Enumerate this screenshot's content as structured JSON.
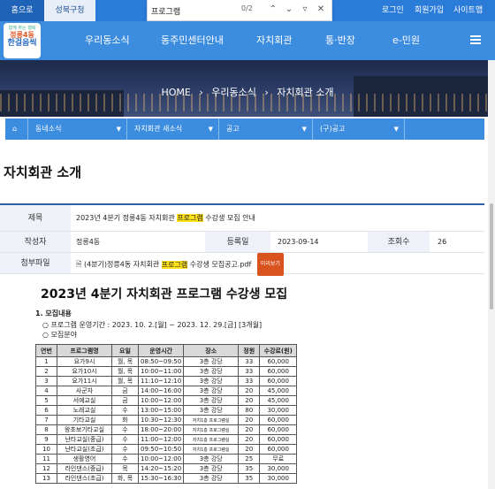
{
  "topbar": {
    "home": "홈으로",
    "district": "성북구청",
    "links": [
      "로그인",
      "회원가입",
      "사이트맵"
    ]
  },
  "findbar": {
    "query": "프로그램",
    "count": "0/2"
  },
  "logo": {
    "line1": "함께 하는 행복",
    "line2": "정릉4동",
    "line3": "한걸음씩"
  },
  "nav": [
    "우리동소식",
    "동주민센터안내",
    "자치회관",
    "통·반장",
    "e-민원"
  ],
  "breadcrumb": [
    "HOME",
    "우리동소식",
    "자치회관 소개"
  ],
  "subnav": [
    "동네소식",
    "자치회관 새소식",
    "공고",
    "(구)공고"
  ],
  "page_title": "자치회관 소개",
  "post": {
    "subject_label": "제목",
    "subject_pre": "2023년 4분기 정릉4동 자치회관 ",
    "subject_hl": "프로그램",
    "subject_post": " 수강생 모집 안내",
    "author_label": "작성자",
    "author": "정릉4동",
    "date_label": "등록일",
    "date": "2023-09-14",
    "views_label": "조회수",
    "views": "26",
    "attach_label": "첨부파일",
    "attach_pre": "(4분기)정릉4동 자치회관 ",
    "attach_hl": "프로그램",
    "attach_post": " 수강생 모집공고.pdf",
    "preview": "미리보기"
  },
  "doc": {
    "title": "2023년 4분기 자치회관 프로그램 수강생 모집",
    "section1": "1. 모집내용",
    "period": "○ 프로그램 운영기간 : 2023. 10. 2.[월] ~ 2023. 12. 29.[금] [3개월]",
    "field": "○ 모집분야",
    "headers": [
      "연번",
      "프로그램명",
      "요일",
      "운영시간",
      "장소",
      "정원",
      "수강료(원)"
    ],
    "rows": [
      [
        "1",
        "요가9시",
        "월, 목",
        "08:50~09:50",
        "3층 강당",
        "33",
        "60,000"
      ],
      [
        "2",
        "요가10시",
        "월, 목",
        "10:00~11:00",
        "3층 강당",
        "33",
        "60,000"
      ],
      [
        "3",
        "요가11시",
        "월, 목",
        "11:10~12:10",
        "3층 강당",
        "33",
        "60,000"
      ],
      [
        "4",
        "사군자",
        "금",
        "14:00~16:00",
        "3층 강당",
        "20",
        "45,000"
      ],
      [
        "5",
        "서예교실",
        "금",
        "10:00~12:00",
        "3층 강당",
        "20",
        "45,000"
      ],
      [
        "6",
        "노래교실",
        "수",
        "13:00~15:00",
        "3층 강당",
        "80",
        "30,000"
      ],
      [
        "7",
        "기타교실",
        "화",
        "10:30~12:30",
        "자치1층 프로그램실",
        "20",
        "60,000"
      ],
      [
        "8",
        "왕초보기타교실",
        "수",
        "18:00~20:00",
        "자치1층 프로그램실",
        "20",
        "60,000"
      ],
      [
        "9",
        "난타교실(중급)",
        "수",
        "11:00~12:00",
        "자치1층 프로그램실",
        "20",
        "60,000"
      ],
      [
        "10",
        "난타교실(초급)",
        "수",
        "09:50~10:50",
        "자치1층 프로그램실",
        "20",
        "60,000"
      ],
      [
        "11",
        "생활영어",
        "수",
        "10:00~12:00",
        "3층 강당",
        "25",
        "무료"
      ],
      [
        "12",
        "라인댄스(중급)",
        "목",
        "14:20~15:20",
        "3층 강당",
        "35",
        "30,000"
      ],
      [
        "13",
        "라인댄스(초급)",
        "화, 목",
        "15:30~16:30",
        "3층 강당",
        "35",
        "30,000"
      ]
    ]
  }
}
